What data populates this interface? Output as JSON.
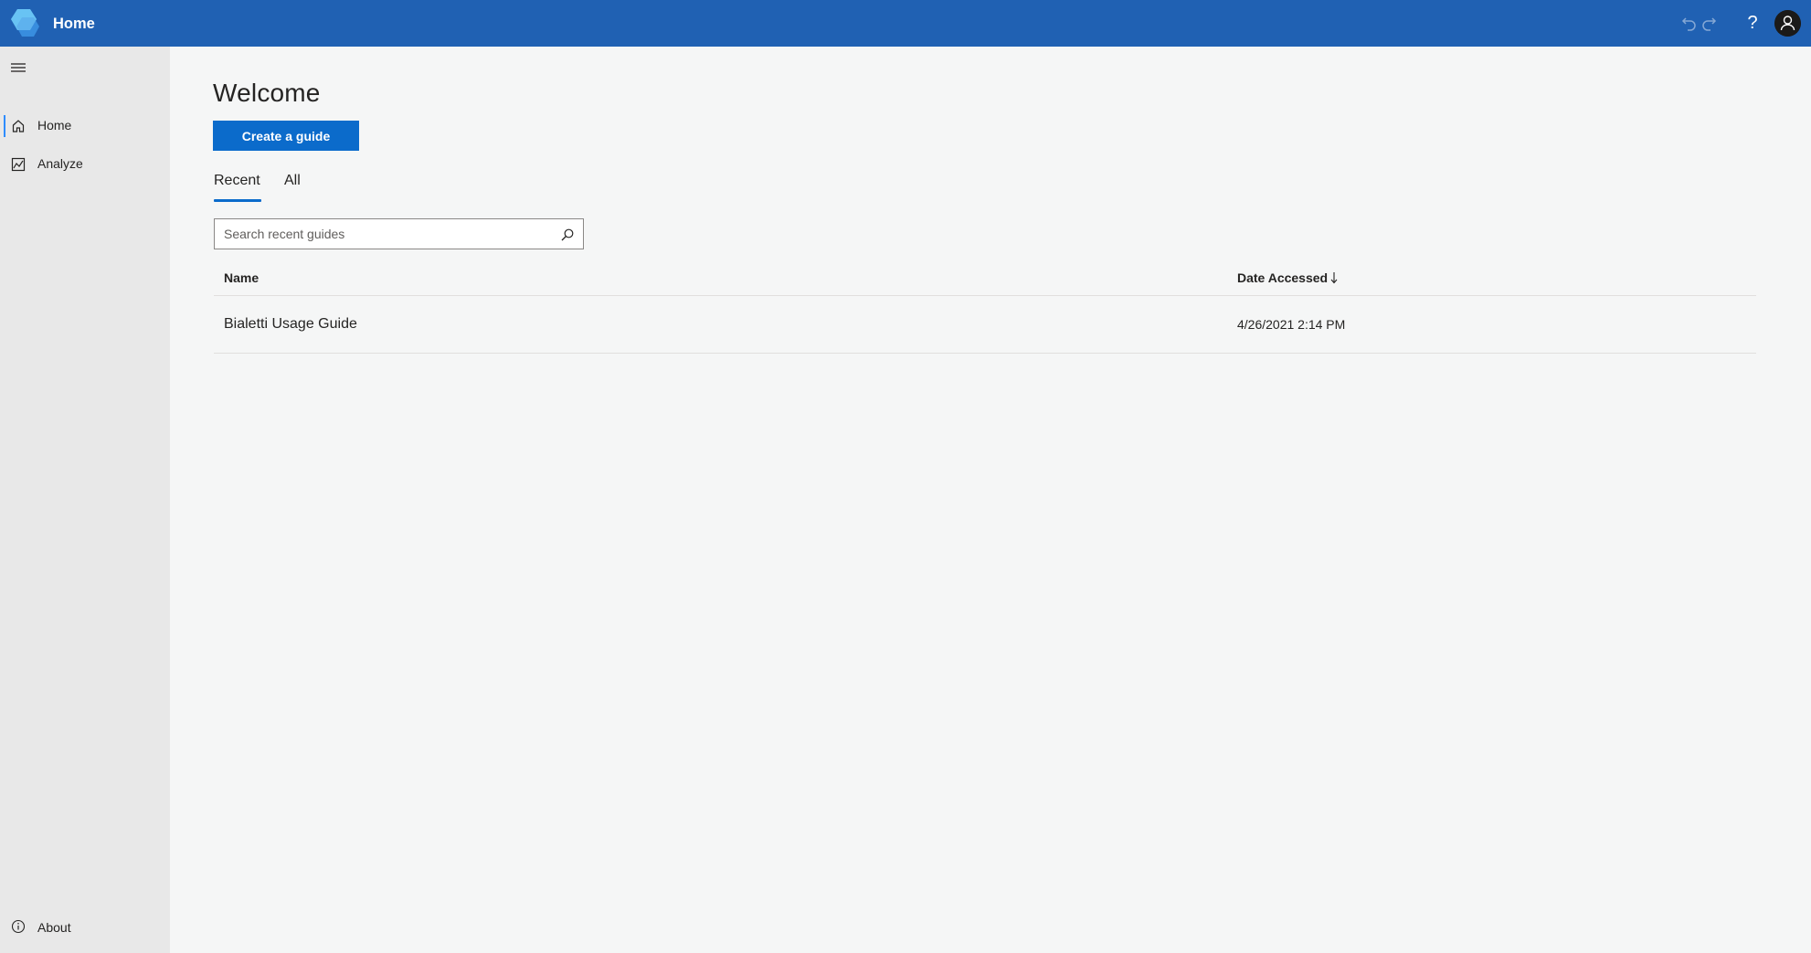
{
  "header": {
    "app_title": "Home",
    "help_label": "?"
  },
  "sidebar": {
    "items": [
      {
        "label": "Home",
        "icon": "home-icon",
        "active": true
      },
      {
        "label": "Analyze",
        "icon": "analyze-icon",
        "active": false
      }
    ],
    "footer": {
      "label": "About",
      "icon": "info-icon"
    }
  },
  "main": {
    "title": "Welcome",
    "create_button": "Create a guide",
    "tabs": [
      {
        "label": "Recent",
        "selected": true
      },
      {
        "label": "All",
        "selected": false
      }
    ],
    "search": {
      "placeholder": "Search recent guides",
      "value": ""
    },
    "table": {
      "columns": [
        "Name",
        "Date Accessed"
      ],
      "sort": {
        "column": "Date Accessed",
        "direction": "descending"
      },
      "rows": [
        {
          "name": "Bialetti Usage Guide",
          "date": "4/26/2021 2:14 PM"
        }
      ]
    }
  },
  "colors": {
    "topbar": "#2061b3",
    "accent": "#0b6bcb",
    "sidebar": "#e8e8e8",
    "background": "#f5f6f6"
  }
}
